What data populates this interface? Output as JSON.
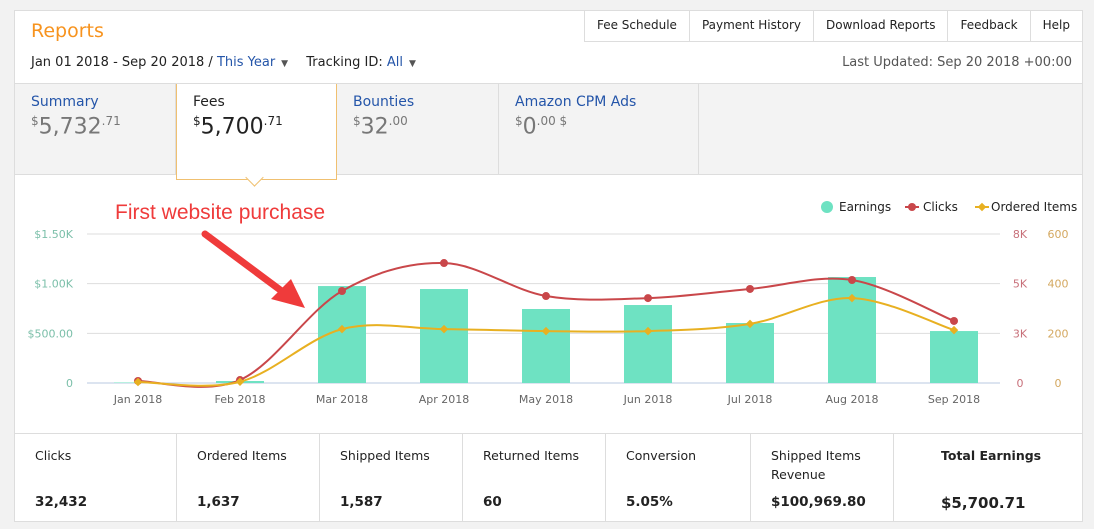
{
  "header": {
    "title": "Reports",
    "nav": [
      "Fee Schedule",
      "Payment History",
      "Download Reports",
      "Feedback",
      "Help"
    ],
    "date_range": "Jan 01 2018 - Sep 20 2018 /",
    "period": "This Year",
    "tracking_label": "Tracking ID:",
    "tracking_value": "All",
    "last_updated": "Last Updated: Sep 20 2018 +00:00"
  },
  "tabs": [
    {
      "label": "Summary",
      "cur": "$",
      "whole": "5,732",
      "cents": ".71",
      "suffix": ""
    },
    {
      "label": "Fees",
      "cur": "$",
      "whole": "5,700",
      "cents": ".71",
      "suffix": ""
    },
    {
      "label": "Bounties",
      "cur": "$",
      "whole": "32",
      "cents": ".00",
      "suffix": ""
    },
    {
      "label": "Amazon CPM Ads",
      "cur": "$",
      "whole": "0",
      "cents": ".00",
      "suffix": " $"
    }
  ],
  "active_tab": "Fees",
  "annotation": "First website purchase",
  "chart_data": {
    "type": "bar+line",
    "categories": [
      "Jan 2018",
      "Feb 2018",
      "Mar 2018",
      "Apr 2018",
      "May 2018",
      "Jun 2018",
      "Jul 2018",
      "Aug 2018",
      "Sep 2018"
    ],
    "series": [
      {
        "name": "Earnings",
        "type": "bar",
        "axis": "left",
        "color": "#6ee2c2",
        "values": [
          5,
          20,
          976,
          946,
          745,
          785,
          604,
          1067,
          523
        ]
      },
      {
        "name": "Clicks",
        "type": "line",
        "axis": "right1",
        "color": "#c9474a",
        "values": [
          110,
          160,
          4940,
          6440,
          4670,
          4560,
          5050,
          5530,
          3330
        ]
      },
      {
        "name": "Ordered Items",
        "type": "line",
        "axis": "right2",
        "color": "#e8b021",
        "values": [
          4,
          5,
          217,
          217,
          209,
          209,
          238,
          342,
          213
        ]
      }
    ],
    "left_axis": {
      "ticks": [
        "0",
        "$500.00",
        "$1.00K",
        "$1.50K"
      ],
      "range": [
        0,
        1500
      ],
      "color": "#7bbfa9"
    },
    "right1_axis": {
      "ticks": [
        "0",
        "3K",
        "5K",
        "8K"
      ],
      "range": [
        0,
        8000
      ],
      "color": "#c8707a"
    },
    "right2_axis": {
      "ticks": [
        "0",
        "200",
        "400",
        "600"
      ],
      "range": [
        0,
        600
      ],
      "color": "#d4a860"
    },
    "legend_position": "top-right",
    "grid": true
  },
  "stats": [
    {
      "label": "Clicks",
      "value": "32,432"
    },
    {
      "label": "Ordered Items",
      "value": "1,637"
    },
    {
      "label": "Shipped Items",
      "value": "1,587"
    },
    {
      "label": "Returned Items",
      "value": "60"
    },
    {
      "label": "Conversion",
      "value": "5.05%"
    },
    {
      "label": "Shipped Items Revenue",
      "value": "$100,969.80"
    },
    {
      "label": "Total Earnings",
      "value": "$5,700.71"
    }
  ]
}
